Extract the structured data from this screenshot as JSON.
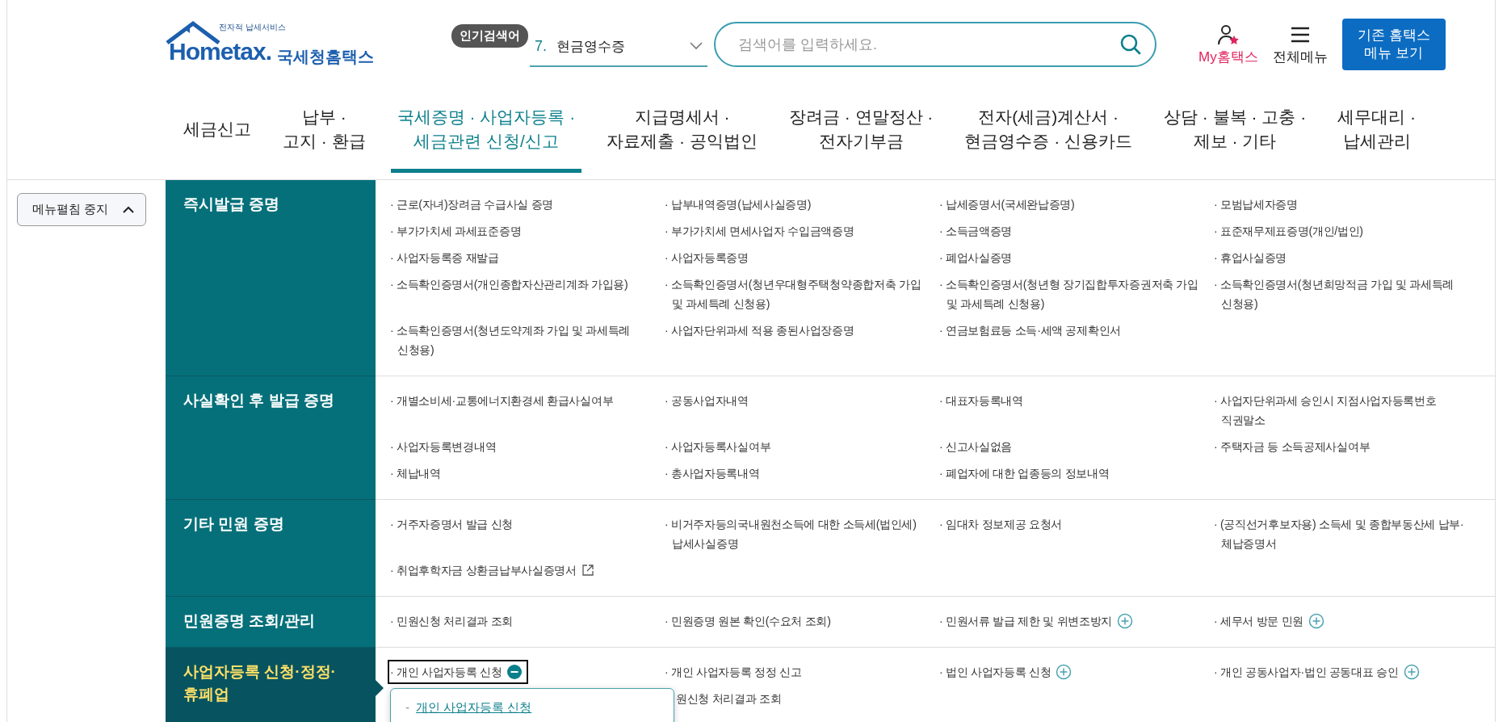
{
  "header": {
    "logo": {
      "tagline": "전자적 납세서비스",
      "brand": "Hometax.",
      "name": "국세청홈택스"
    },
    "popular_search": {
      "badge": "인기검색어",
      "rank": "7.",
      "term": "현금영수증"
    },
    "search": {
      "placeholder": "검색어를 입력하세요."
    },
    "my_hometax": "My홈택스",
    "all_menu": "전체메뉴",
    "classic_button": [
      "기존 홈택스",
      "메뉴 보기"
    ]
  },
  "nav": [
    {
      "lines": [
        "세금신고"
      ],
      "selected": false
    },
    {
      "lines": [
        "납부 ·",
        "고지 · 환급"
      ],
      "selected": false
    },
    {
      "lines": [
        "국세증명 · 사업자등록 ·",
        "세금관련 신청/신고"
      ],
      "selected": true
    },
    {
      "lines": [
        "지급명세서 ·",
        "자료제출 · 공익법인"
      ],
      "selected": false
    },
    {
      "lines": [
        "장려금 · 연말정산 ·",
        "전자기부금"
      ],
      "selected": false
    },
    {
      "lines": [
        "전자(세금)계산서 ·",
        "현금영수증 · 신용카드"
      ],
      "selected": false
    },
    {
      "lines": [
        "상담 · 불복 · 고충 ·",
        "제보 · 기타"
      ],
      "selected": false
    },
    {
      "lines": [
        "세무대리 ·",
        "납세관리"
      ],
      "selected": false
    }
  ],
  "sidebar": {
    "toggle_button": "메뉴펼침 중지"
  },
  "sections": [
    {
      "title_lines": [
        "즉시발급 증명"
      ],
      "selected": false,
      "items": [
        {
          "kind": "link",
          "text": "· 근로(자녀)장려금 수급사실 증명"
        },
        {
          "kind": "link",
          "text": "· 납부내역증명(납세사실증명)"
        },
        {
          "kind": "link",
          "text": "· 납세증명서(국세완납증명)"
        },
        {
          "kind": "link",
          "text": "· 모범납세자증명"
        },
        {
          "kind": "link",
          "text": "· 부가가치세 과세표준증명"
        },
        {
          "kind": "link",
          "text": "· 부가가치세 면세사업자 수입금액증명"
        },
        {
          "kind": "link",
          "text": "· 소득금액증명"
        },
        {
          "kind": "link",
          "text": "· 표준재무제표증명(개인/법인)"
        },
        {
          "kind": "link",
          "text": "· 사업자등록증 재발급"
        },
        {
          "kind": "link",
          "text": "· 사업자등록증명"
        },
        {
          "kind": "link",
          "text": "· 폐업사실증명"
        },
        {
          "kind": "link",
          "text": "· 휴업사실증명"
        },
        {
          "kind": "link",
          "text": "· 소득확인증명서(개인종합자산관리계좌 가입용)"
        },
        {
          "kind": "link",
          "text": "· 소득확인증명서(청년우대형주택청약종합저축 가입 및 과세특례 신청용)"
        },
        {
          "kind": "link",
          "text": "· 소득확인증명서(청년형 장기집합투자증권저축 가입 및 과세특례 신청용)"
        },
        {
          "kind": "link",
          "text": "· 소득확인증명서(청년희망적금 가입 및 과세특례 신청용)"
        },
        {
          "kind": "link",
          "text": "· 소득확인증명서(청년도약계좌 가입 및 과세특례 신청용)"
        },
        {
          "kind": "link",
          "text": "· 사업자단위과세 적용 종된사업장증명"
        },
        {
          "kind": "link",
          "text": "· 연금보험료등 소득·세액 공제확인서"
        }
      ]
    },
    {
      "title_lines": [
        "사실확인 후 발급 증명"
      ],
      "selected": false,
      "items": [
        {
          "kind": "link",
          "text": "· 개별소비세·교통에너지환경세 환급사실여부"
        },
        {
          "kind": "link",
          "text": "· 공동사업자내역"
        },
        {
          "kind": "link",
          "text": "· 대표자등록내역"
        },
        {
          "kind": "link",
          "text": "· 사업자단위과세 승인시 지점사업자등록번호 직권말소"
        },
        {
          "kind": "link",
          "text": "· 사업자등록변경내역"
        },
        {
          "kind": "link",
          "text": "· 사업자등록사실여부"
        },
        {
          "kind": "link",
          "text": "· 신고사실없음"
        },
        {
          "kind": "link",
          "text": "· 주택자금 등 소득공제사실여부"
        },
        {
          "kind": "link",
          "text": "· 체납내역"
        },
        {
          "kind": "link",
          "text": "· 총사업자등록내역"
        },
        {
          "kind": "link",
          "text": "· 폐업자에 대한 업종등의 정보내역"
        }
      ]
    },
    {
      "title_lines": [
        "기타 민원 증명"
      ],
      "selected": false,
      "items": [
        {
          "kind": "link",
          "text": "· 거주자증명서 발급 신청"
        },
        {
          "kind": "link",
          "text": "· 비거주자등의국내원천소득에 대한 소득세(법인세) 납세사실증명"
        },
        {
          "kind": "link",
          "text": "· 임대차 정보제공 요청서"
        },
        {
          "kind": "link",
          "text": "· (공직선거후보자용) 소득세 및 종합부동산세 납부·체납증명서"
        },
        {
          "kind": "external",
          "text": "· 취업후학자금 상환금납부사실증명서"
        }
      ]
    },
    {
      "title_lines": [
        "민원증명 조회/관리"
      ],
      "selected": false,
      "items": [
        {
          "kind": "link",
          "text": "· 민원신청 처리결과 조회"
        },
        {
          "kind": "link",
          "text": "· 민원증명 원본 확인(수요처 조회)"
        },
        {
          "kind": "toggle",
          "expanded": false,
          "text": "· 민원서류 발급 제한 및 위변조방지"
        },
        {
          "kind": "toggle",
          "expanded": false,
          "text": "· 세무서 방문 민원"
        }
      ]
    },
    {
      "title_lines": [
        "사업자등록 신청·정정·",
        "휴폐업"
      ],
      "selected": true,
      "items": [
        {
          "kind": "toggle",
          "expanded": true,
          "text": "· 개인 사업자등록 신청",
          "submenu": [
            {
              "marker": "-",
              "label": "개인 사업자등록 신청"
            }
          ]
        },
        {
          "kind": "link",
          "text": "· 개인 사업자등록 정정 신고"
        },
        {
          "kind": "toggle",
          "expanded": false,
          "text": "· 법인 사업자등록 신청"
        },
        {
          "kind": "toggle",
          "expanded": false,
          "text": "· 개인 공동사업자·법인 공동대표 승인"
        },
        {
          "kind": "spacer"
        },
        {
          "kind": "covered",
          "text": "원신청 처리결과 조회"
        }
      ]
    }
  ]
}
